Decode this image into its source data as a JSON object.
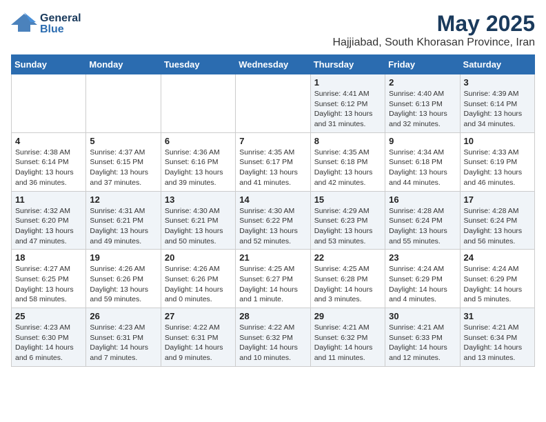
{
  "header": {
    "logo": {
      "general": "General",
      "blue": "Blue"
    },
    "title": "May 2025",
    "subtitle": "Hajjiabad, South Khorasan Province, Iran"
  },
  "days_of_week": [
    "Sunday",
    "Monday",
    "Tuesday",
    "Wednesday",
    "Thursday",
    "Friday",
    "Saturday"
  ],
  "weeks": [
    [
      {
        "day": "",
        "info": ""
      },
      {
        "day": "",
        "info": ""
      },
      {
        "day": "",
        "info": ""
      },
      {
        "day": "",
        "info": ""
      },
      {
        "day": "1",
        "info": "Sunrise: 4:41 AM\nSunset: 6:12 PM\nDaylight: 13 hours\nand 31 minutes."
      },
      {
        "day": "2",
        "info": "Sunrise: 4:40 AM\nSunset: 6:13 PM\nDaylight: 13 hours\nand 32 minutes."
      },
      {
        "day": "3",
        "info": "Sunrise: 4:39 AM\nSunset: 6:14 PM\nDaylight: 13 hours\nand 34 minutes."
      }
    ],
    [
      {
        "day": "4",
        "info": "Sunrise: 4:38 AM\nSunset: 6:14 PM\nDaylight: 13 hours\nand 36 minutes."
      },
      {
        "day": "5",
        "info": "Sunrise: 4:37 AM\nSunset: 6:15 PM\nDaylight: 13 hours\nand 37 minutes."
      },
      {
        "day": "6",
        "info": "Sunrise: 4:36 AM\nSunset: 6:16 PM\nDaylight: 13 hours\nand 39 minutes."
      },
      {
        "day": "7",
        "info": "Sunrise: 4:35 AM\nSunset: 6:17 PM\nDaylight: 13 hours\nand 41 minutes."
      },
      {
        "day": "8",
        "info": "Sunrise: 4:35 AM\nSunset: 6:18 PM\nDaylight: 13 hours\nand 42 minutes."
      },
      {
        "day": "9",
        "info": "Sunrise: 4:34 AM\nSunset: 6:18 PM\nDaylight: 13 hours\nand 44 minutes."
      },
      {
        "day": "10",
        "info": "Sunrise: 4:33 AM\nSunset: 6:19 PM\nDaylight: 13 hours\nand 46 minutes."
      }
    ],
    [
      {
        "day": "11",
        "info": "Sunrise: 4:32 AM\nSunset: 6:20 PM\nDaylight: 13 hours\nand 47 minutes."
      },
      {
        "day": "12",
        "info": "Sunrise: 4:31 AM\nSunset: 6:21 PM\nDaylight: 13 hours\nand 49 minutes."
      },
      {
        "day": "13",
        "info": "Sunrise: 4:30 AM\nSunset: 6:21 PM\nDaylight: 13 hours\nand 50 minutes."
      },
      {
        "day": "14",
        "info": "Sunrise: 4:30 AM\nSunset: 6:22 PM\nDaylight: 13 hours\nand 52 minutes."
      },
      {
        "day": "15",
        "info": "Sunrise: 4:29 AM\nSunset: 6:23 PM\nDaylight: 13 hours\nand 53 minutes."
      },
      {
        "day": "16",
        "info": "Sunrise: 4:28 AM\nSunset: 6:24 PM\nDaylight: 13 hours\nand 55 minutes."
      },
      {
        "day": "17",
        "info": "Sunrise: 4:28 AM\nSunset: 6:24 PM\nDaylight: 13 hours\nand 56 minutes."
      }
    ],
    [
      {
        "day": "18",
        "info": "Sunrise: 4:27 AM\nSunset: 6:25 PM\nDaylight: 13 hours\nand 58 minutes."
      },
      {
        "day": "19",
        "info": "Sunrise: 4:26 AM\nSunset: 6:26 PM\nDaylight: 13 hours\nand 59 minutes."
      },
      {
        "day": "20",
        "info": "Sunrise: 4:26 AM\nSunset: 6:26 PM\nDaylight: 14 hours\nand 0 minutes."
      },
      {
        "day": "21",
        "info": "Sunrise: 4:25 AM\nSunset: 6:27 PM\nDaylight: 14 hours\nand 1 minute."
      },
      {
        "day": "22",
        "info": "Sunrise: 4:25 AM\nSunset: 6:28 PM\nDaylight: 14 hours\nand 3 minutes."
      },
      {
        "day": "23",
        "info": "Sunrise: 4:24 AM\nSunset: 6:29 PM\nDaylight: 14 hours\nand 4 minutes."
      },
      {
        "day": "24",
        "info": "Sunrise: 4:24 AM\nSunset: 6:29 PM\nDaylight: 14 hours\nand 5 minutes."
      }
    ],
    [
      {
        "day": "25",
        "info": "Sunrise: 4:23 AM\nSunset: 6:30 PM\nDaylight: 14 hours\nand 6 minutes."
      },
      {
        "day": "26",
        "info": "Sunrise: 4:23 AM\nSunset: 6:31 PM\nDaylight: 14 hours\nand 7 minutes."
      },
      {
        "day": "27",
        "info": "Sunrise: 4:22 AM\nSunset: 6:31 PM\nDaylight: 14 hours\nand 9 minutes."
      },
      {
        "day": "28",
        "info": "Sunrise: 4:22 AM\nSunset: 6:32 PM\nDaylight: 14 hours\nand 10 minutes."
      },
      {
        "day": "29",
        "info": "Sunrise: 4:21 AM\nSunset: 6:32 PM\nDaylight: 14 hours\nand 11 minutes."
      },
      {
        "day": "30",
        "info": "Sunrise: 4:21 AM\nSunset: 6:33 PM\nDaylight: 14 hours\nand 12 minutes."
      },
      {
        "day": "31",
        "info": "Sunrise: 4:21 AM\nSunset: 6:34 PM\nDaylight: 14 hours\nand 13 minutes."
      }
    ]
  ]
}
